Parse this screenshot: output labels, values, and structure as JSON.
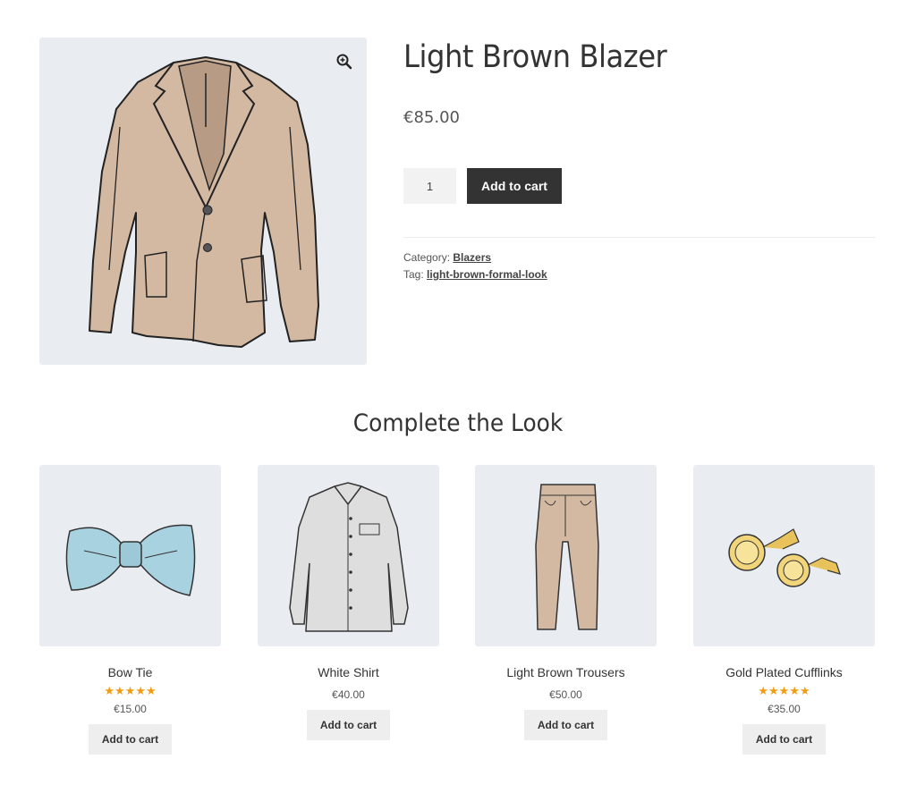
{
  "product": {
    "title": "Light Brown Blazer",
    "price": "€85.00",
    "quantity": "1",
    "add_to_cart_label": "Add to cart",
    "category_label": "Category:",
    "category_value": "Blazers",
    "tag_label": "Tag:",
    "tag_value": "light-brown-formal-look",
    "image_icon": "blazer-illustration",
    "zoom_icon": "zoom-in-icon"
  },
  "related": {
    "title": "Complete the Look",
    "items": [
      {
        "name": "Bow Tie",
        "rating": 5,
        "stars": "★★★★★",
        "price": "€15.00",
        "button": "Add to cart",
        "icon": "bow-tie-illustration"
      },
      {
        "name": "White Shirt",
        "rating": null,
        "stars": "",
        "price": "€40.00",
        "button": "Add to cart",
        "icon": "shirt-illustration"
      },
      {
        "name": "Light Brown Trousers",
        "rating": null,
        "stars": "",
        "price": "€50.00",
        "button": "Add to cart",
        "icon": "trousers-illustration"
      },
      {
        "name": "Gold Plated Cufflinks",
        "rating": 5,
        "stars": "★★★★★",
        "price": "€35.00",
        "button": "Add to cart",
        "icon": "cufflinks-illustration"
      }
    ]
  },
  "colors": {
    "image_bg": "#e9edf2",
    "primary_button": "#333333",
    "secondary_button": "#eeeeee",
    "star": "#f39c12"
  }
}
